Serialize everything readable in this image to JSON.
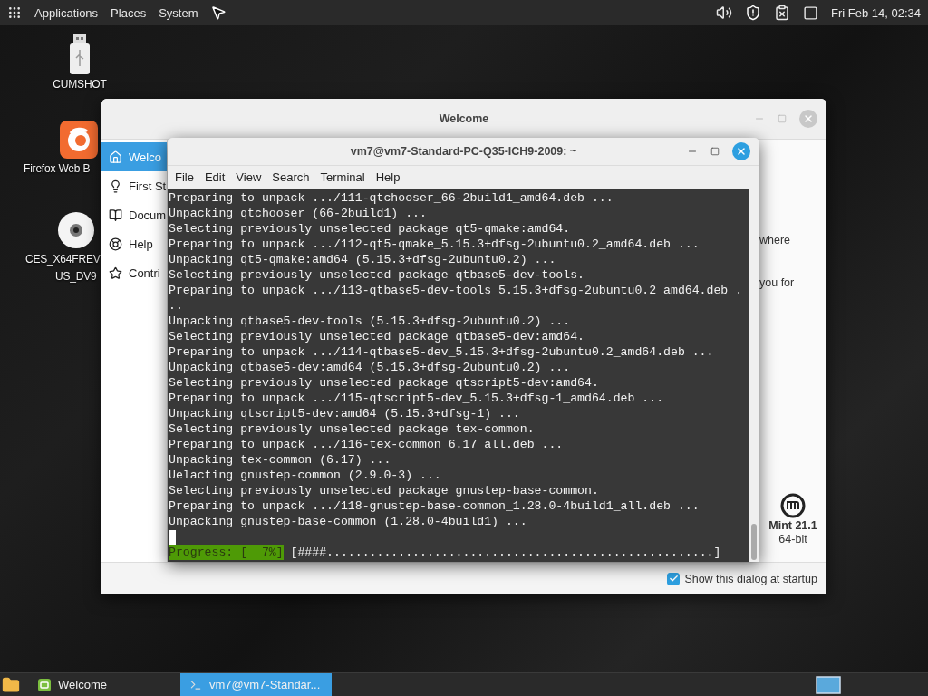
{
  "top_panel": {
    "menus": [
      "Applications",
      "Places",
      "System"
    ],
    "clock": "Fri Feb 14, 02:34"
  },
  "desktop_icons": [
    {
      "kind": "usb",
      "label_lines": [
        "CUMSHOT"
      ]
    },
    {
      "kind": "browser",
      "label_lines": [
        "Firefox Web B"
      ]
    },
    {
      "kind": "disc",
      "label_lines": [
        "CES_X64FREV",
        "US_DV9"
      ]
    }
  ],
  "welcome_window": {
    "title": "Welcome",
    "sidebar": [
      {
        "kind": "home",
        "label": "Welco",
        "selected": true
      },
      {
        "kind": "bulb",
        "label": "First St",
        "selected": false
      },
      {
        "kind": "book",
        "label": "Docum",
        "selected": false
      },
      {
        "kind": "help",
        "label": "Help",
        "selected": false
      },
      {
        "kind": "star",
        "label": "Contri",
        "selected": false
      }
    ],
    "visible_text": [
      "where",
      "you for"
    ],
    "edition": {
      "name": "Mint 21.1",
      "arch": "64-bit"
    },
    "startup_checkbox": {
      "label": "Show this dialog at startup",
      "checked": true
    }
  },
  "terminal_window": {
    "title": "vm7@vm7-Standard-PC-Q35-ICH9-2009: ~",
    "menus": [
      "File",
      "Edit",
      "View",
      "Search",
      "Terminal",
      "Help"
    ],
    "lines": [
      "Preparing to unpack .../111-qtchooser_66-2build1_amd64.deb ...",
      "Unpacking qtchooser (66-2build1) ...",
      "Selecting previously unselected package qt5-qmake:amd64.",
      "Preparing to unpack .../112-qt5-qmake_5.15.3+dfsg-2ubuntu0.2_amd64.deb ...",
      "Unpacking qt5-qmake:amd64 (5.15.3+dfsg-2ubuntu0.2) ...",
      "Selecting previously unselected package qtbase5-dev-tools.",
      "Preparing to unpack .../113-qtbase5-dev-tools_5.15.3+dfsg-2ubuntu0.2_amd64.deb .",
      "..",
      "Unpacking qtbase5-dev-tools (5.15.3+dfsg-2ubuntu0.2) ...",
      "Selecting previously unselected package qtbase5-dev:amd64.",
      "Preparing to unpack .../114-qtbase5-dev_5.15.3+dfsg-2ubuntu0.2_amd64.deb ...",
      "Unpacking qtbase5-dev:amd64 (5.15.3+dfsg-2ubuntu0.2) ...",
      "Selecting previously unselected package qtscript5-dev:amd64.",
      "Preparing to unpack .../115-qtscript5-dev_5.15.3+dfsg-1_amd64.deb ...",
      "Unpacking qtscript5-dev:amd64 (5.15.3+dfsg-1) ...",
      "Selecting previously unselected package tex-common.",
      "Preparing to unpack .../116-tex-common_6.17_all.deb ...",
      "Unpacking tex-common (6.17) ...",
      "Uelacting gnustep-common (2.9.0-3) ...",
      "Selecting previously unselected package gnustep-base-common.",
      "Preparing to unpack .../118-gnustep-base-common_1.28.0-4build1_all.deb ...",
      "Unpacking gnustep-base-common (1.28.0-4build1) ..."
    ],
    "progress": {
      "label": "Progress: [  7%]",
      "bar": "[####......................................................]"
    }
  },
  "taskbar": {
    "items": [
      {
        "kind": "welcome",
        "label": "Welcome",
        "selected": false
      },
      {
        "kind": "terminal",
        "label": "vm7@vm7-Standar...",
        "selected": true
      }
    ]
  }
}
